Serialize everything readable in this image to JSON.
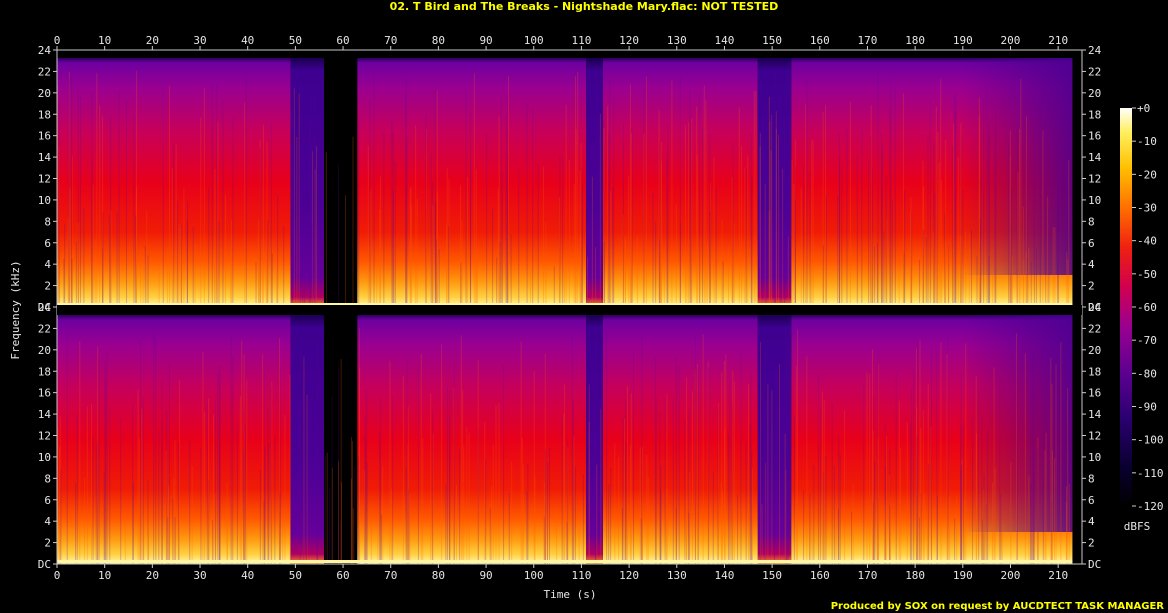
{
  "title": "02. T Bird and The Breaks - Nightshade Mary.flac: NOT TESTED",
  "footer": "Produced by SOX on request by AUCDTECT TASK MANAGER",
  "chart_data": {
    "type": "heatmap",
    "title": "02. T Bird and The Breaks - Nightshade Mary.flac: NOT TESTED",
    "xlabel": "Time (s)",
    "ylabel": "Frequency (kHz)",
    "xlim": [
      0,
      215
    ],
    "ylim_khz": [
      0,
      24
    ],
    "x_ticks": [
      0,
      10,
      20,
      30,
      40,
      50,
      60,
      70,
      80,
      90,
      100,
      110,
      120,
      130,
      140,
      150,
      160,
      170,
      180,
      190,
      200,
      210
    ],
    "y_tick_labels": [
      "DC",
      "2",
      "4",
      "6",
      "8",
      "10",
      "12",
      "14",
      "16",
      "18",
      "20",
      "22",
      "24"
    ],
    "y_tick_values": [
      0,
      2,
      4,
      6,
      8,
      10,
      12,
      14,
      16,
      18,
      20,
      22,
      24
    ],
    "channels": 2,
    "colorbar": {
      "label": "dBFS",
      "ticks": [
        "+0",
        "-10",
        "-20",
        "-30",
        "-40",
        "-50",
        "-60",
        "-70",
        "-80",
        "-90",
        "-100",
        "-110",
        "-120"
      ],
      "range": [
        -120,
        0
      ]
    },
    "quiet_sections_s": [
      [
        49,
        56
      ],
      [
        111,
        114.5
      ],
      [
        147,
        154
      ]
    ],
    "loud_sections_s": [
      [
        0,
        49
      ],
      [
        63,
        111
      ],
      [
        114.5,
        147
      ],
      [
        154,
        213
      ]
    ],
    "fade_out_start_s": 190,
    "end_s": 213,
    "accent_colors": {
      "title": "#ffff00",
      "axis": "#e6e6e6",
      "background": "#000000"
    }
  }
}
